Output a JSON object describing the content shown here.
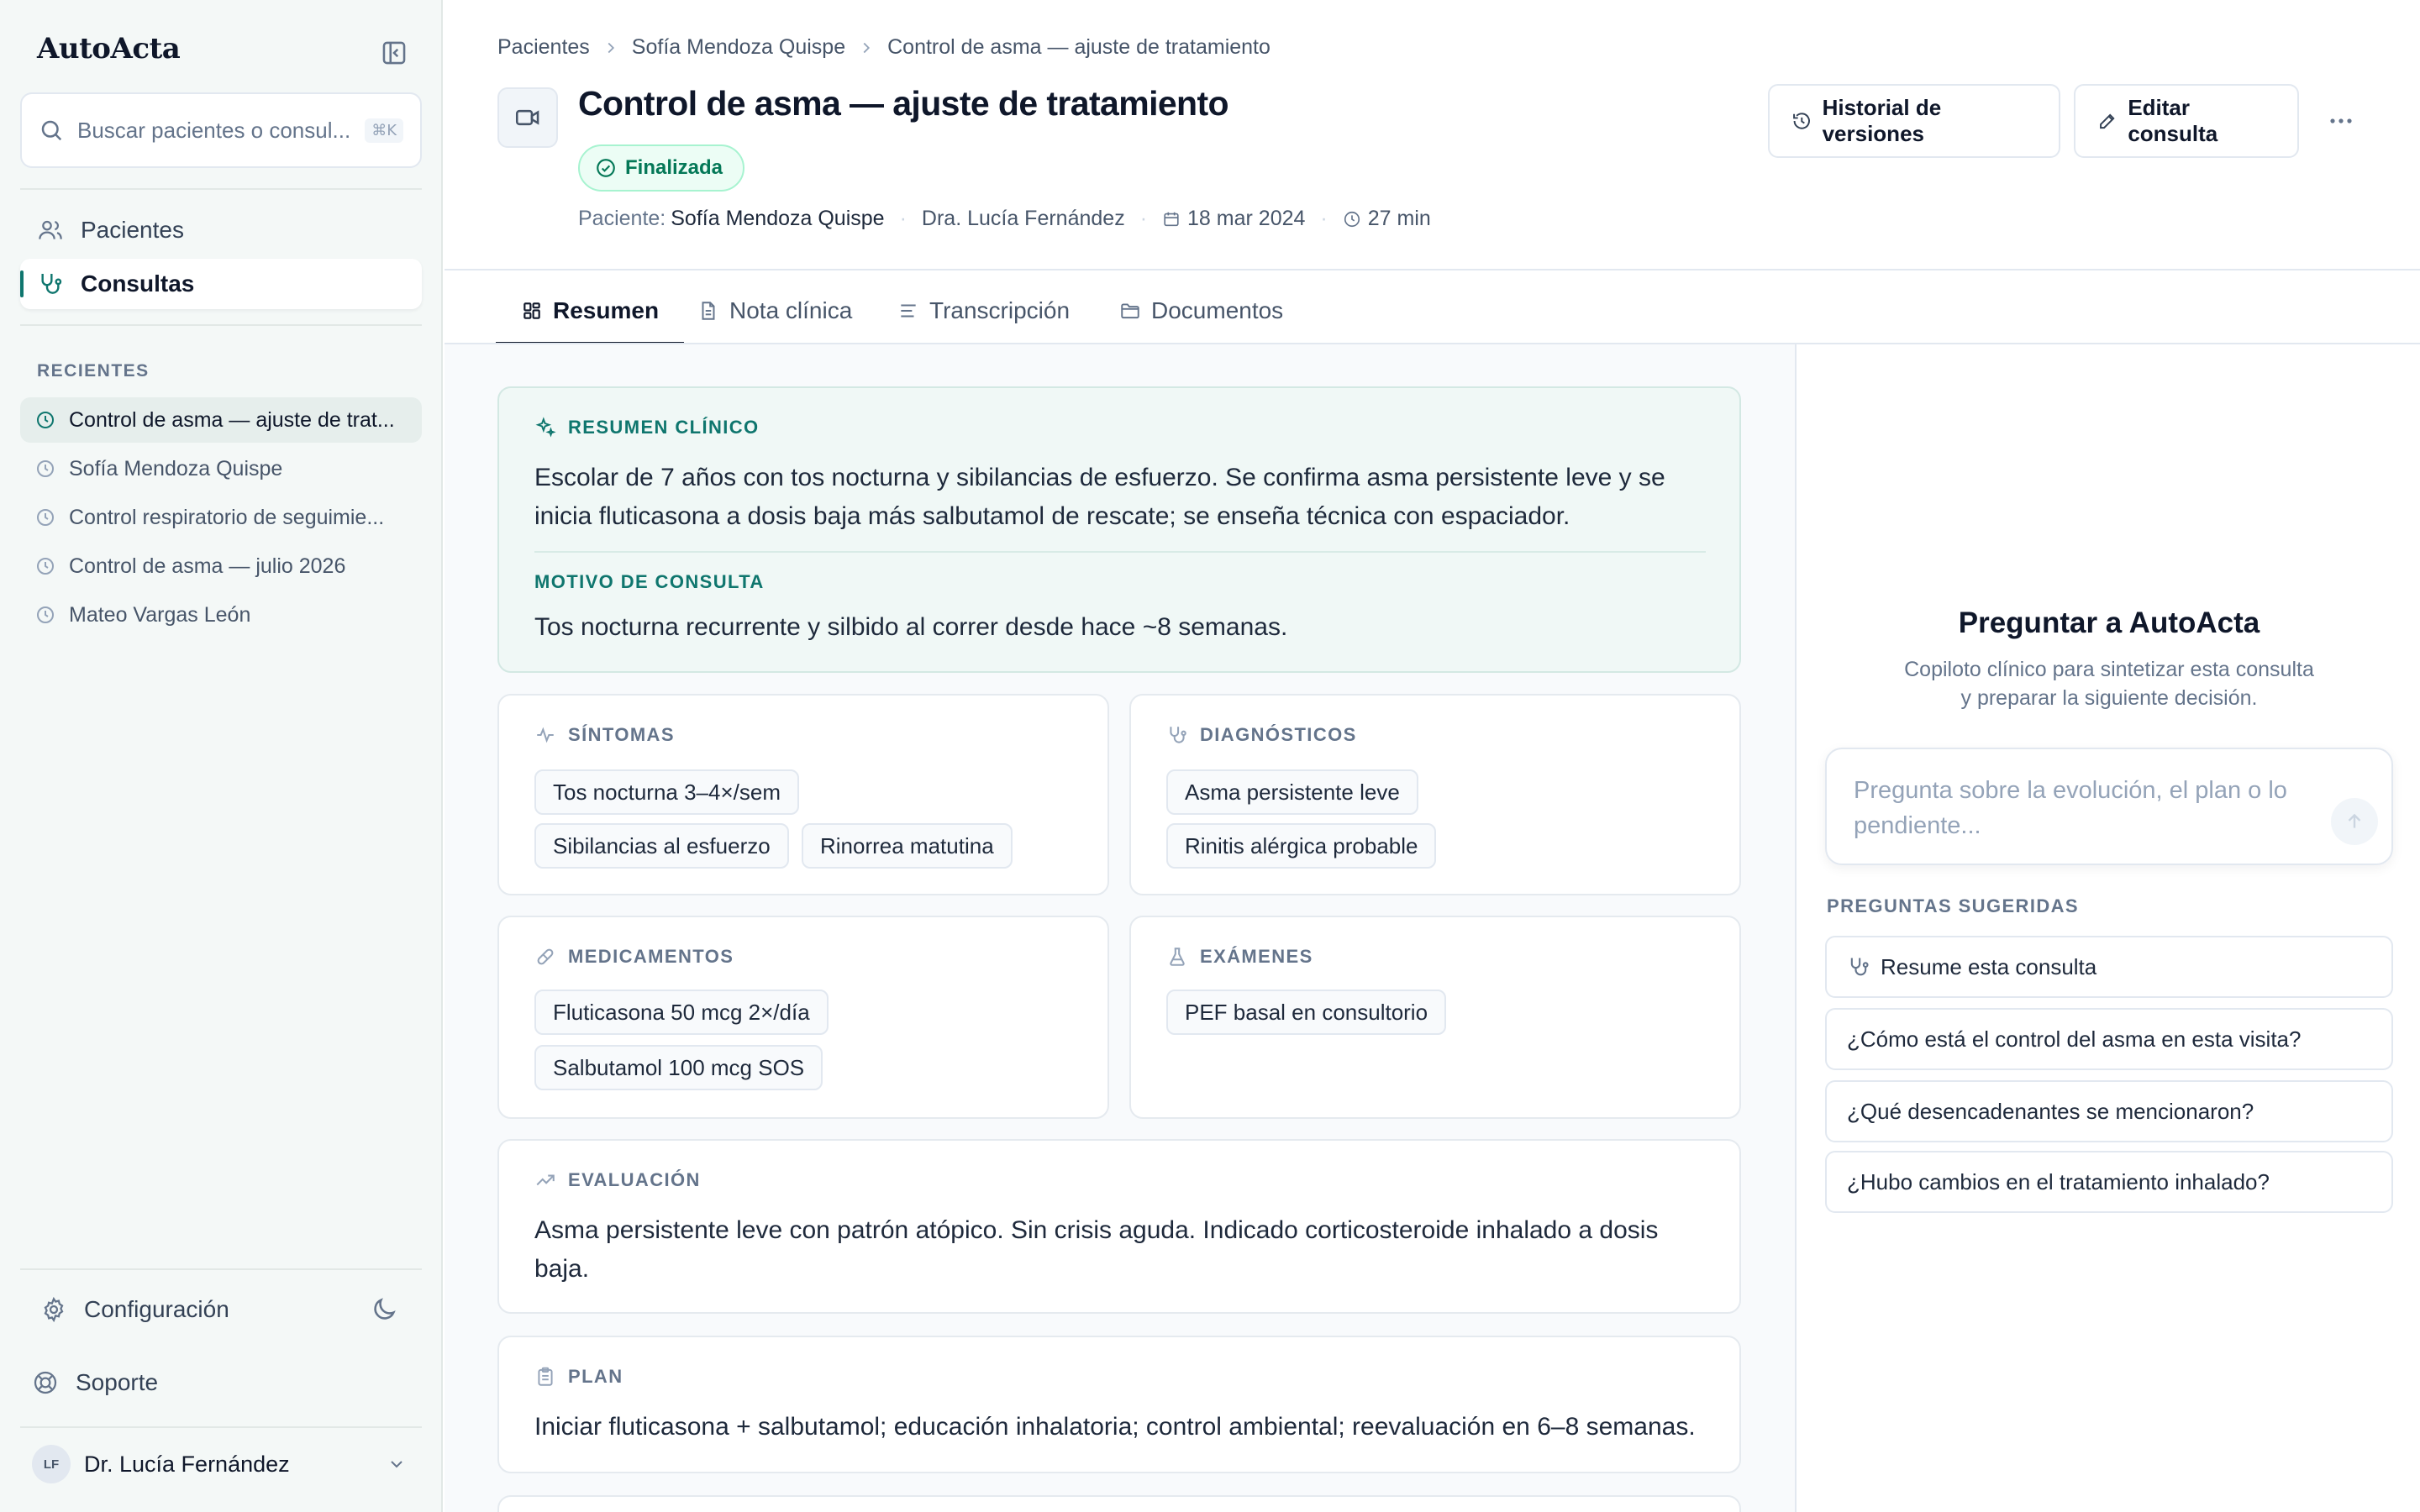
{
  "sidebar": {
    "brand": "AutoActa",
    "search_placeholder": "Buscar pacientes o consul...",
    "search_shortcut": "⌘K",
    "nav": [
      {
        "label": "Pacientes",
        "icon": "users-icon"
      },
      {
        "label": "Consultas",
        "icon": "stethoscope-icon"
      }
    ],
    "recent_label": "RECIENTES",
    "recent": [
      "Control de asma — ajuste de trat...",
      "Sofía Mendoza Quispe",
      "Control respiratorio de seguimie...",
      "Control de asma — julio 2026",
      "Mateo Vargas León"
    ],
    "settings_label": "Configuración",
    "support_label": "Soporte",
    "user_initials": "LF",
    "user_name": "Dr. Lucía Fernández"
  },
  "header": {
    "breadcrumb": [
      "Pacientes",
      "Sofía Mendoza Quispe",
      "Control de asma — ajuste de tratamiento"
    ],
    "title": "Control de asma — ajuste de tratamiento",
    "status": "Finalizada",
    "patient_label": "Paciente:",
    "patient_name": "Sofía Mendoza Quispe",
    "doctor": "Dra. Lucía Fernández",
    "date": "18 mar 2024",
    "duration": "27 min",
    "history_button": "Historial de versiones",
    "edit_button": "Editar consulta"
  },
  "tabs": [
    "Resumen",
    "Nota clínica",
    "Transcripción",
    "Documentos"
  ],
  "summary": {
    "label": "RESUMEN CLÍNICO",
    "text": "Escolar de 7 años con tos nocturna y sibilancias de esfuerzo. Se confirma asma persistente leve y se inicia fluticasona a dosis baja más salbutamol de rescate; se enseña técnica con espaciador.",
    "reason_label": "MOTIVO DE CONSULTA",
    "reason_text": "Tos nocturna recurrente y silbido al correr desde hace ~8 semanas."
  },
  "symptoms": {
    "label": "SÍNTOMAS",
    "items": [
      "Tos nocturna 3–4×/sem",
      "Sibilancias al esfuerzo",
      "Rinorrea matutina"
    ]
  },
  "diagnoses": {
    "label": "DIAGNÓSTICOS",
    "items": [
      "Asma persistente leve",
      "Rinitis alérgica probable"
    ]
  },
  "medications": {
    "label": "MEDICAMENTOS",
    "items": [
      "Fluticasona 50 mcg 2×/día",
      "Salbutamol 100 mcg SOS"
    ]
  },
  "exams": {
    "label": "EXÁMENES",
    "items": [
      "PEF basal en consultorio"
    ]
  },
  "evaluation": {
    "label": "EVALUACIÓN",
    "text": "Asma persistente leve con patrón atópico. Sin crisis aguda. Indicado corticosteroide inhalado a dosis baja."
  },
  "plan": {
    "label": "PLAN",
    "text": "Iniciar fluticasona + salbutamol; educación inhalatoria; control ambiental; reevaluación en 6–8 semanas."
  },
  "assistant": {
    "title": "Preguntar a AutoActa",
    "subtitle": "Copiloto clínico para sintetizar esta consulta y preparar la siguiente decisión.",
    "placeholder": "Pregunta sobre la evolución, el plan o lo pendiente...",
    "suggested_label": "PREGUNTAS SUGERIDAS",
    "suggestions": [
      "Resume esta consulta",
      "¿Cómo está el control del asma en esta visita?",
      "¿Qué desencadenantes se mencionaron?",
      "¿Hubo cambios en el tratamiento inhalado?"
    ]
  },
  "colors": {
    "accent": "#0f766e",
    "summary_bg": "#f0f8f6",
    "status_green": "#047857"
  }
}
